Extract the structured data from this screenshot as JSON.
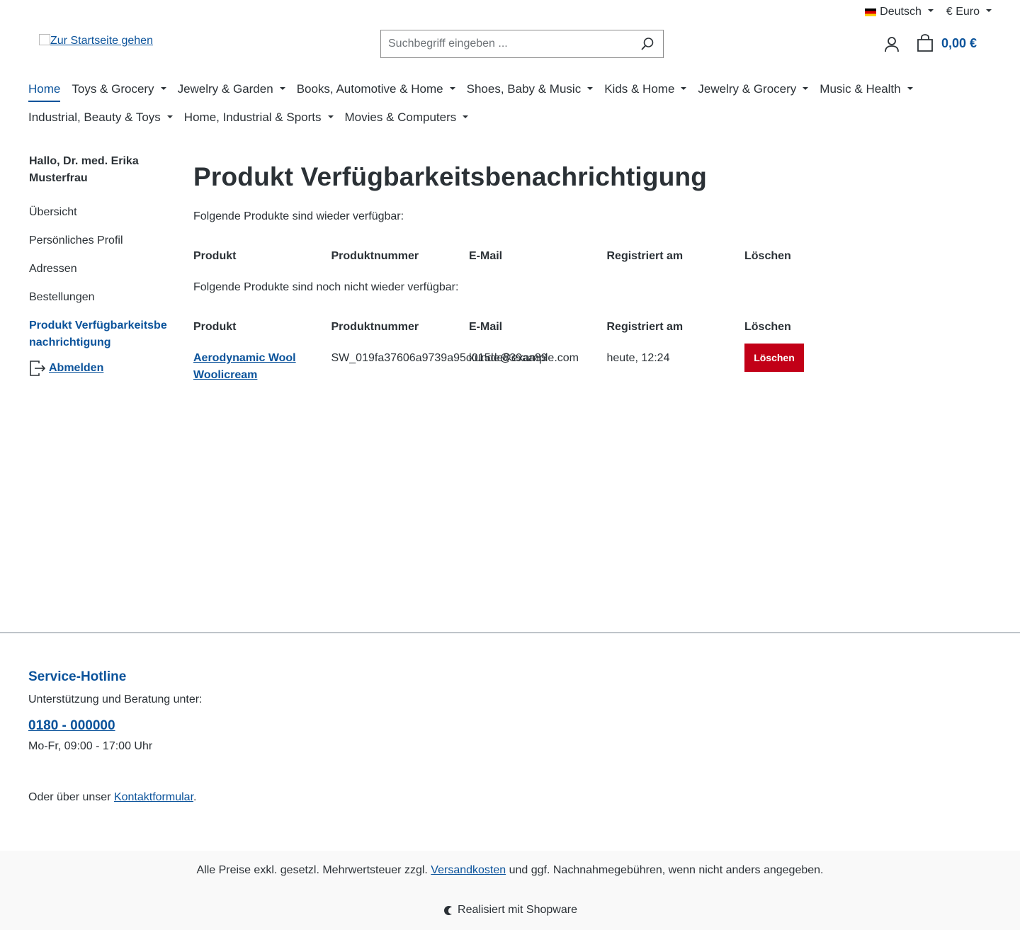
{
  "topbar": {
    "language": "Deutsch",
    "currency": "€ Euro"
  },
  "header": {
    "logo_alt": "Zur Startseite gehen",
    "search_placeholder": "Suchbegriff eingeben ...",
    "cart_total": "0,00 €"
  },
  "nav": {
    "row1": [
      {
        "label": "Home"
      },
      {
        "label": "Toys & Grocery"
      },
      {
        "label": "Jewelry & Garden"
      },
      {
        "label": "Books, Automotive & Home"
      },
      {
        "label": "Shoes, Baby & Music"
      },
      {
        "label": "Kids & Home"
      },
      {
        "label": "Jewelry & Grocery"
      },
      {
        "label": "Music & Health"
      }
    ],
    "row2": [
      {
        "label": "Industrial, Beauty & Toys"
      },
      {
        "label": "Home, Industrial & Sports"
      },
      {
        "label": "Movies & Computers"
      }
    ]
  },
  "sidebar": {
    "greeting": "Hallo, Dr. med. Erika Musterfrau",
    "items": [
      {
        "label": "Übersicht"
      },
      {
        "label": "Persönliches Profil"
      },
      {
        "label": "Adressen"
      },
      {
        "label": "Bestellungen"
      },
      {
        "label": "Produkt Verfügbarkeitsbenachrichtigung"
      }
    ],
    "logout": "Abmelden"
  },
  "main": {
    "title": "Produkt Verfügbarkeitsbenachrichtigung",
    "available_text": "Folgende Produkte sind wieder verfügbar:",
    "unavailable_text": "Folgende Produkte sind noch nicht wieder verfügbar:",
    "columns": [
      "Produkt",
      "Produktnummer",
      "E-Mail",
      "Registriert am",
      "Löschen"
    ],
    "unavailable_rows": [
      {
        "product": "Aerodynamic Wool Woolicream",
        "number": "SW_019fa37606a9739a95c015de839aa89",
        "email": "kunde@example.com",
        "registered": "heute, 12:24",
        "delete_label": "Löschen"
      }
    ]
  },
  "footer": {
    "hotline_title": "Service-Hotline",
    "support_text": "Unterstützung und Beratung unter:",
    "phone": "0180 - 000000",
    "hours": "Mo-Fr, 09:00 - 17:00 Uhr",
    "contact_prefix": "Oder über unser ",
    "contact_link": "Kontaktformular",
    "contact_suffix": ".",
    "vat_prefix": "Alle Preise exkl. gesetzl. Mehrwertsteuer zzgl. ",
    "vat_link": "Versandkosten",
    "vat_suffix": " und ggf. Nachnahmegebühren, wenn nicht anders angegeben.",
    "made_with": "Realisiert mit Shopware"
  },
  "colors": {
    "primary": "#0b539b",
    "danger": "#c20017",
    "text": "#2b3136"
  }
}
